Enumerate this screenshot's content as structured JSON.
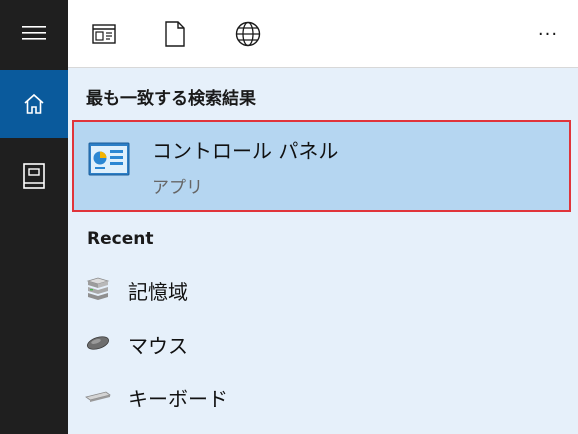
{
  "toolbar": {
    "icons": [
      "apps-icon",
      "document-icon",
      "web-icon"
    ],
    "more_label": "···"
  },
  "results": {
    "section_title": "最も一致する検索結果",
    "best_match": {
      "title": "コントロール パネル",
      "subtitle": "アプリ",
      "icon": "control-panel-icon"
    },
    "recent_title": "Recent",
    "recent_items": [
      {
        "label": "記憶域",
        "icon": "storage-icon"
      },
      {
        "label": "マウス",
        "icon": "mouse-icon"
      },
      {
        "label": "キーボード",
        "icon": "keyboard-icon"
      }
    ]
  },
  "colors": {
    "rail_bg": "#1f1f1f",
    "rail_active": "#0a5a9c",
    "results_bg": "#e6f0fa",
    "selected_bg": "#b5d6f1",
    "highlight_border": "#e0343a"
  }
}
